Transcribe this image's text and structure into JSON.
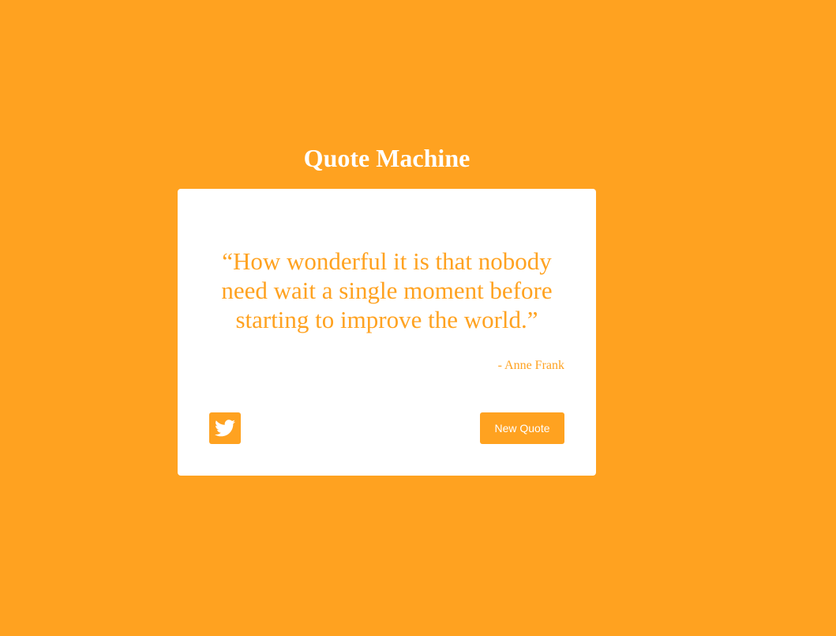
{
  "app": {
    "title": "Quote Machine"
  },
  "quote": {
    "text": "“How wonderful it is that nobody need wait a single moment before starting to improve the world.”",
    "author": "- Anne Frank"
  },
  "actions": {
    "tweet_icon": "twitter-icon",
    "new_quote_label": "New Quote"
  },
  "colors": {
    "background": "#FFA220",
    "card": "#ffffff",
    "accent": "#FFA220"
  }
}
